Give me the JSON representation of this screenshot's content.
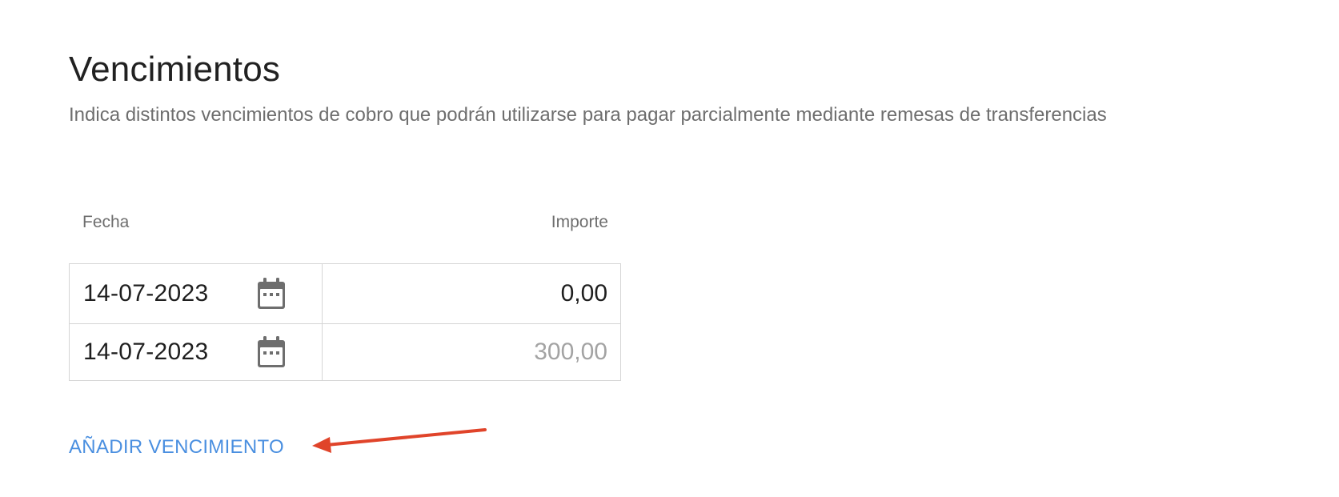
{
  "section": {
    "title": "Vencimientos",
    "description": "Indica distintos vencimientos de cobro que podrán utilizarse para pagar parcialmente mediante remesas de transferencias"
  },
  "table": {
    "headers": {
      "date": "Fecha",
      "amount": "Importe"
    },
    "rows": [
      {
        "date": "14-07-2023",
        "amount_value": "0,00",
        "amount_placeholder": ""
      },
      {
        "date": "14-07-2023",
        "amount_value": "",
        "amount_placeholder": "300,00"
      }
    ]
  },
  "actions": {
    "add_label": "AÑADIR VENCIMIENTO"
  },
  "annotation": {
    "arrow_color": "#e0442a"
  },
  "colors": {
    "link": "#4a8fe0",
    "border": "#d5d5d5",
    "icon": "#6e6e6e"
  },
  "icons": {
    "date_picker": "calendar-icon"
  }
}
